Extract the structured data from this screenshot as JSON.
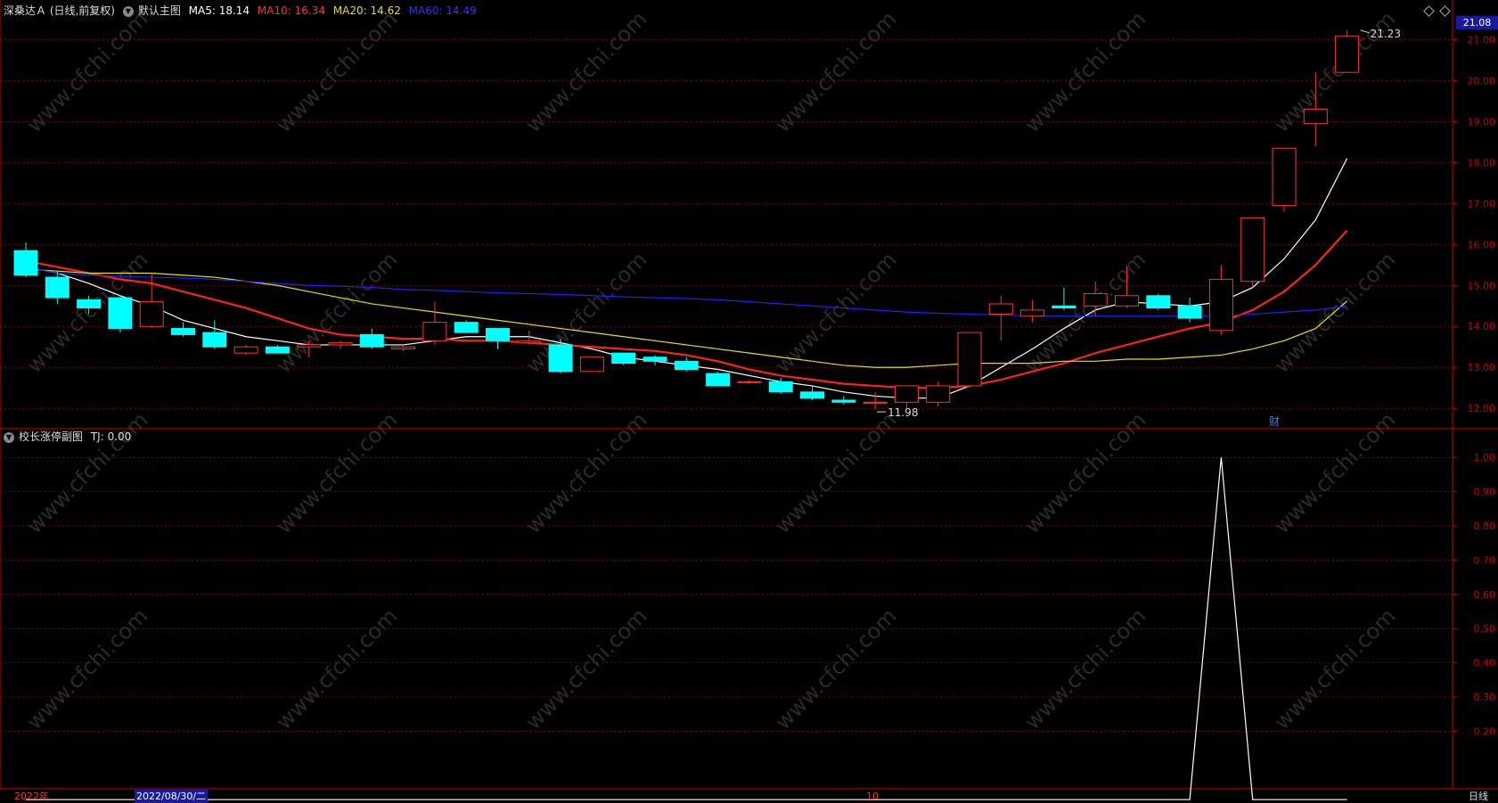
{
  "header": {
    "stock_title": "深桑达Ａ (日线,前复权)",
    "main_chart_name": "默认主图",
    "ma5": "MA5: 18.14",
    "ma10": "MA10: 16.34",
    "ma20": "MA20: 14.62",
    "ma60": "MA60: 14.49"
  },
  "sub_header": {
    "indicator_name": "校长涨停副图",
    "tj_value": "TJ: 0.00"
  },
  "colors": {
    "bg": "#000000",
    "up": "#ff3232",
    "down": "#00ffff",
    "ma5": "#ffffff",
    "ma10": "#ff2020",
    "ma20": "#e8e000",
    "ma60": "#2020ff",
    "grid": "#7a0000",
    "axis": "#c80000",
    "watermark": "#2a2a2a"
  },
  "last_price_tag": "21.08",
  "high_label": "21.23",
  "low_label": "11.98",
  "finance_marker": "财",
  "bottom_bar": {
    "year": "2022年",
    "date": "2022/08/30/二",
    "month": "10",
    "period": "日线"
  },
  "watermark_text": "www.cfchi.com",
  "chart_data": [
    {
      "type": "candlestick",
      "title": "深桑达Ａ (日线,前复权)",
      "ylim": [
        11.7,
        21.4
      ],
      "yticks": [
        "12.00",
        "13.00",
        "14.00",
        "15.00",
        "16.00",
        "17.00",
        "18.00",
        "19.00",
        "20.00",
        "21.00"
      ],
      "ytick_values": [
        12,
        13,
        14,
        15,
        16,
        17,
        18,
        19,
        20,
        21
      ],
      "candles": [
        {
          "o": 15.85,
          "h": 16.05,
          "l": 15.2,
          "c": 15.25
        },
        {
          "o": 15.2,
          "h": 15.35,
          "l": 14.55,
          "c": 14.7
        },
        {
          "o": 14.65,
          "h": 14.75,
          "l": 14.3,
          "c": 14.45
        },
        {
          "o": 14.7,
          "h": 14.75,
          "l": 13.85,
          "c": 13.95
        },
        {
          "o": 14.0,
          "h": 15.3,
          "l": 13.95,
          "c": 14.6
        },
        {
          "o": 13.95,
          "h": 14.1,
          "l": 13.75,
          "c": 13.8
        },
        {
          "o": 13.85,
          "h": 14.15,
          "l": 13.45,
          "c": 13.5
        },
        {
          "o": 13.35,
          "h": 13.55,
          "l": 13.3,
          "c": 13.5
        },
        {
          "o": 13.5,
          "h": 13.55,
          "l": 13.35,
          "c": 13.35
        },
        {
          "o": 13.5,
          "h": 13.65,
          "l": 13.25,
          "c": 13.55
        },
        {
          "o": 13.55,
          "h": 13.65,
          "l": 13.45,
          "c": 13.6
        },
        {
          "o": 13.8,
          "h": 13.95,
          "l": 13.45,
          "c": 13.5
        },
        {
          "o": 13.45,
          "h": 13.55,
          "l": 13.4,
          "c": 13.5
        },
        {
          "o": 13.65,
          "h": 14.6,
          "l": 13.55,
          "c": 14.1
        },
        {
          "o": 14.1,
          "h": 14.15,
          "l": 13.85,
          "c": 13.85
        },
        {
          "o": 13.95,
          "h": 13.95,
          "l": 13.45,
          "c": 13.65
        },
        {
          "o": 13.6,
          "h": 13.9,
          "l": 13.55,
          "c": 13.65
        },
        {
          "o": 13.55,
          "h": 13.7,
          "l": 12.85,
          "c": 12.9
        },
        {
          "o": 12.9,
          "h": 13.25,
          "l": 12.9,
          "c": 13.25
        },
        {
          "o": 13.35,
          "h": 13.35,
          "l": 13.05,
          "c": 13.1
        },
        {
          "o": 13.25,
          "h": 13.3,
          "l": 13.05,
          "c": 13.15
        },
        {
          "o": 13.15,
          "h": 13.25,
          "l": 12.9,
          "c": 12.95
        },
        {
          "o": 12.85,
          "h": 12.9,
          "l": 12.55,
          "c": 12.55
        },
        {
          "o": 12.65,
          "h": 12.7,
          "l": 12.6,
          "c": 12.65
        },
        {
          "o": 12.65,
          "h": 12.75,
          "l": 12.35,
          "c": 12.4
        },
        {
          "o": 12.4,
          "h": 12.55,
          "l": 12.2,
          "c": 12.25
        },
        {
          "o": 12.2,
          "h": 12.3,
          "l": 12.1,
          "c": 12.15
        },
        {
          "o": 12.15,
          "h": 12.4,
          "l": 11.98,
          "c": 12.15
        },
        {
          "o": 12.15,
          "h": 12.55,
          "l": 12.0,
          "c": 12.55
        },
        {
          "o": 12.15,
          "h": 12.65,
          "l": 12.05,
          "c": 12.55
        },
        {
          "o": 12.55,
          "h": 13.85,
          "l": 12.5,
          "c": 13.85
        },
        {
          "o": 14.3,
          "h": 14.75,
          "l": 13.65,
          "c": 14.55
        },
        {
          "o": 14.25,
          "h": 14.65,
          "l": 14.1,
          "c": 14.4
        },
        {
          "o": 14.5,
          "h": 14.95,
          "l": 14.4,
          "c": 14.45
        },
        {
          "o": 14.5,
          "h": 15.1,
          "l": 14.25,
          "c": 14.8
        },
        {
          "o": 14.5,
          "h": 15.45,
          "l": 14.45,
          "c": 14.75
        },
        {
          "o": 14.75,
          "h": 14.8,
          "l": 14.4,
          "c": 14.45
        },
        {
          "o": 14.5,
          "h": 14.7,
          "l": 14.1,
          "c": 14.2
        },
        {
          "o": 13.9,
          "h": 15.5,
          "l": 13.8,
          "c": 15.15
        },
        {
          "o": 15.1,
          "h": 16.65,
          "l": 14.95,
          "c": 16.65
        },
        {
          "o": 16.95,
          "h": 18.35,
          "l": 16.8,
          "c": 18.35
        },
        {
          "o": 18.95,
          "h": 20.2,
          "l": 18.4,
          "c": 19.3
        },
        {
          "o": 20.2,
          "h": 21.23,
          "l": 20.2,
          "c": 21.08
        }
      ],
      "ma_lines": [
        {
          "name": "MA5",
          "values": [
            15.45,
            15.3,
            15.05,
            14.75,
            14.5,
            14.15,
            13.95,
            13.75,
            13.65,
            13.55,
            13.55,
            13.55,
            13.55,
            13.65,
            13.75,
            13.75,
            13.75,
            13.6,
            13.45,
            13.25,
            13.15,
            13.05,
            12.95,
            12.8,
            12.65,
            12.55,
            12.4,
            12.3,
            12.25,
            12.25,
            12.55,
            13.0,
            13.45,
            13.95,
            14.4,
            14.6,
            14.55,
            14.5,
            14.6,
            14.95,
            15.65,
            16.6,
            18.1
          ]
        },
        {
          "name": "MA10",
          "values": [
            15.6,
            15.45,
            15.3,
            15.15,
            15.05,
            14.85,
            14.65,
            14.45,
            14.2,
            13.95,
            13.8,
            13.75,
            13.7,
            13.7,
            13.65,
            13.65,
            13.6,
            13.55,
            13.5,
            13.45,
            13.4,
            13.3,
            13.15,
            12.95,
            12.8,
            12.7,
            12.6,
            12.55,
            12.5,
            12.5,
            12.55,
            12.7,
            12.9,
            13.1,
            13.35,
            13.55,
            13.75,
            13.95,
            14.1,
            14.4,
            14.85,
            15.5,
            16.34
          ]
        },
        {
          "name": "MA20",
          "values": [
            15.4,
            15.35,
            15.3,
            15.3,
            15.3,
            15.25,
            15.2,
            15.1,
            15.0,
            14.85,
            14.7,
            14.55,
            14.45,
            14.35,
            14.25,
            14.15,
            14.05,
            13.95,
            13.85,
            13.75,
            13.65,
            13.55,
            13.45,
            13.35,
            13.25,
            13.15,
            13.05,
            13.0,
            13.0,
            13.05,
            13.1,
            13.1,
            13.1,
            13.15,
            13.15,
            13.2,
            13.2,
            13.25,
            13.3,
            13.45,
            13.65,
            13.95,
            14.62
          ]
        },
        {
          "name": "MA60",
          "values": [
            15.45,
            15.3,
            15.25,
            15.22,
            15.2,
            15.18,
            15.15,
            15.1,
            15.05,
            15.0,
            14.98,
            14.95,
            14.9,
            14.88,
            14.85,
            14.82,
            14.8,
            14.78,
            14.75,
            14.72,
            14.7,
            14.68,
            14.65,
            14.6,
            14.55,
            14.5,
            14.45,
            14.4,
            14.35,
            14.32,
            14.3,
            14.28,
            14.25,
            14.25,
            14.25,
            14.25,
            14.25,
            14.25,
            14.25,
            14.3,
            14.35,
            14.4,
            14.49
          ]
        }
      ]
    },
    {
      "type": "line",
      "title": "校长涨停副图",
      "ylim": [
        0.05,
        1.05
      ],
      "yticks": [
        "0.20",
        "0.30",
        "0.40",
        "0.50",
        "0.60",
        "0.70",
        "0.80",
        "0.90",
        "1.00"
      ],
      "ytick_values": [
        0.2,
        0.3,
        0.4,
        0.5,
        0.6,
        0.7,
        0.8,
        0.9,
        1.0
      ],
      "series": [
        {
          "name": "TJ",
          "values": [
            0,
            0,
            0,
            0,
            0,
            0,
            0,
            0,
            0,
            0,
            0,
            0,
            0,
            0,
            0,
            0,
            0,
            0,
            0,
            0,
            0,
            0,
            0,
            0,
            0,
            0,
            0,
            0,
            0,
            0,
            0,
            0,
            0,
            0,
            0,
            0,
            0,
            0,
            1,
            0,
            0,
            0,
            0
          ]
        }
      ]
    }
  ]
}
